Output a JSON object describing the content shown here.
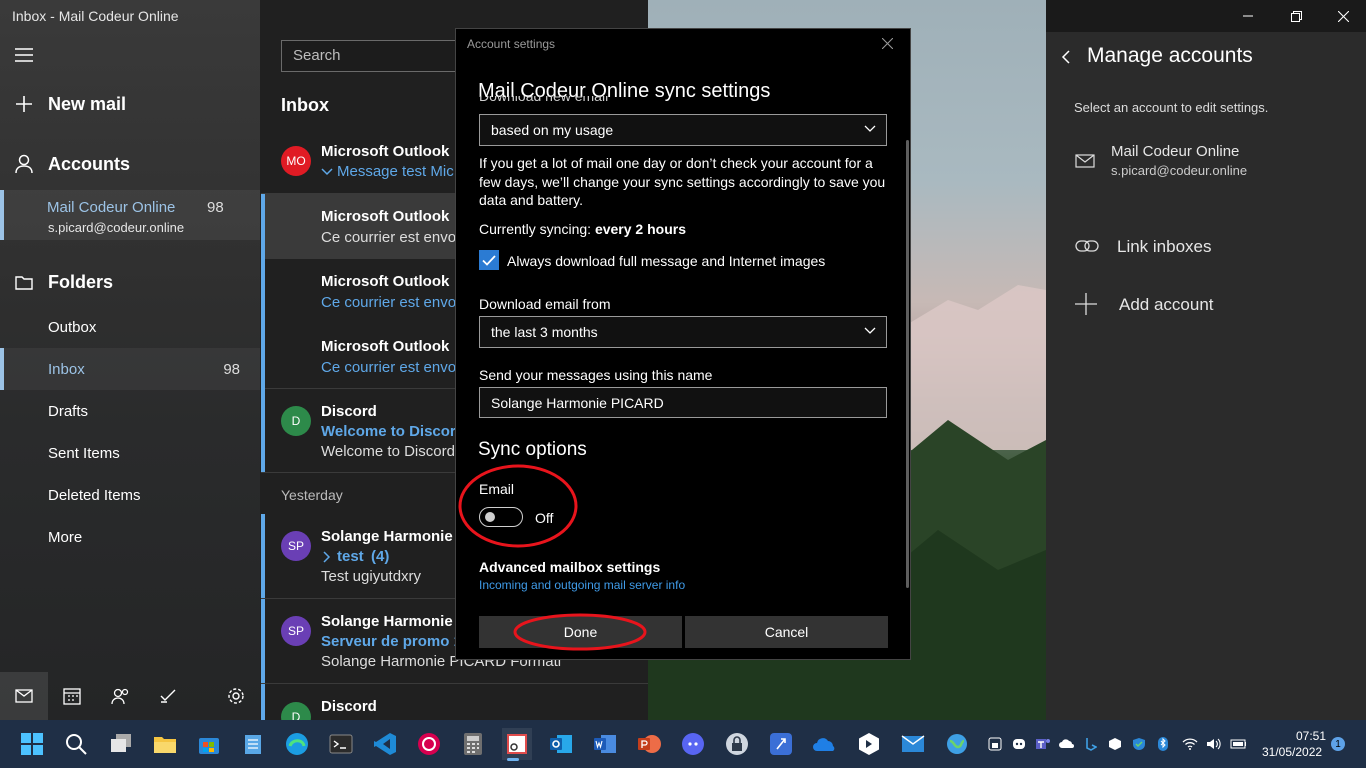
{
  "window": {
    "title": "Inbox - Mail Codeur Online"
  },
  "nav": {
    "new_mail": "New mail",
    "accounts": "Accounts",
    "account": {
      "name": "Mail Codeur Online",
      "email": "s.picard@codeur.online",
      "count": "98"
    },
    "folders": "Folders",
    "folder_items": [
      {
        "label": "Outbox",
        "count": ""
      },
      {
        "label": "Inbox",
        "count": "98"
      },
      {
        "label": "Drafts",
        "count": ""
      },
      {
        "label": "Sent Items",
        "count": ""
      },
      {
        "label": "Deleted Items",
        "count": ""
      },
      {
        "label": "More",
        "count": ""
      }
    ]
  },
  "list": {
    "search_placeholder": "Search",
    "title": "Inbox",
    "yesterday": "Yesterday",
    "messages": [
      {
        "avatar": "MO",
        "avatar_color": "#e01b24",
        "from": "Microsoft Outlook",
        "subject": "Message test Mic",
        "preview": ""
      },
      {
        "avatar": "",
        "from": "Microsoft Outlook",
        "subject": "",
        "preview": "Ce courrier est envoy"
      },
      {
        "avatar": "",
        "from": "Microsoft Outlook",
        "subject": "Ce courrier est envoy",
        "preview": ""
      },
      {
        "avatar": "",
        "from": "Microsoft Outlook",
        "subject": "Ce courrier est envoy",
        "preview": ""
      },
      {
        "avatar": "D",
        "avatar_color": "#2d8a4a",
        "from": "Discord",
        "subject": "Welcome to Discord",
        "preview": "Welcome to Discord"
      },
      {
        "avatar": "SP",
        "avatar_color": "#6a3fb5",
        "from": "Solange Harmonie I",
        "subject": "test",
        "count": "(4)",
        "preview": "Test ugiyutdxry"
      },
      {
        "avatar": "SP",
        "avatar_color": "#6a3fb5",
        "from": "Solange Harmonie I",
        "subject": "Serveur de promo 1",
        "preview": "Solange Harmonie PICARD Formati"
      },
      {
        "avatar": "D",
        "avatar_color": "#2d8a4a",
        "from": "Discord",
        "subject": "",
        "preview": ""
      }
    ]
  },
  "manage": {
    "title": "Manage accounts",
    "subtitle": "Select an account to edit settings.",
    "account_name": "Mail Codeur Online",
    "account_email": "s.picard@codeur.online",
    "link_inboxes": "Link inboxes",
    "add_account": "Add account"
  },
  "dialog": {
    "caption": "Account settings",
    "heading": "Mail Codeur Online sync settings",
    "cut_label": "Download new email",
    "download_new_value": "based on my usage",
    "description": "If you get a lot of mail one day or don’t check your account for a few days, we’ll change your sync settings accordingly to save you data and battery.",
    "currently_label": "Currently syncing:",
    "currently_value": "every 2 hours",
    "full_message_label": "Always download full message and Internet images",
    "download_from_label": "Download email from",
    "download_from_value": "the last 3 months",
    "send_name_label": "Send your messages using this name",
    "send_name_value": "Solange Harmonie PICARD",
    "sync_options": "Sync options",
    "email_label": "Email",
    "email_toggle_state": "Off",
    "advanced_title": "Advanced mailbox settings",
    "advanced_link": "Incoming and outgoing mail server info",
    "done": "Done",
    "cancel": "Cancel",
    "annotation_color": "#e8141c"
  },
  "taskbar": {
    "time": "07:51",
    "date": "31/05/2022",
    "notifications": "1"
  }
}
